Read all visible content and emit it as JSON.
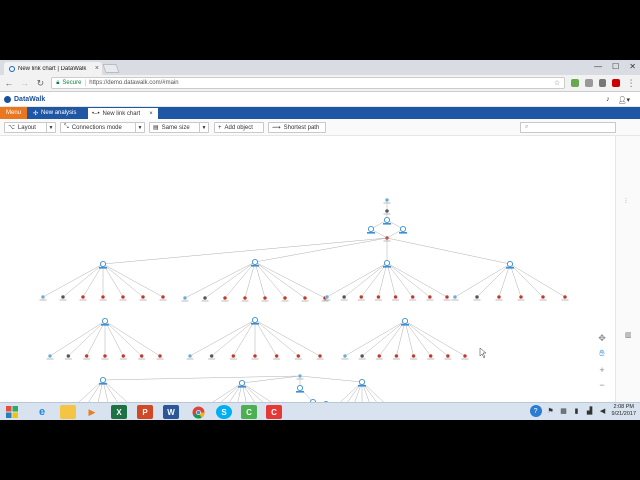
{
  "browser": {
    "tab_title": "New link chart | DataWalk",
    "tab_close": "×",
    "secure_label": "Secure",
    "url": "https://demo.datawalk.com/#main",
    "window_controls": [
      "—",
      "☐",
      "✕"
    ]
  },
  "app": {
    "logo_text": "DataWalk",
    "menu_label": "Menu",
    "tabs": [
      {
        "label": "New analysis",
        "icon": "network-icon"
      },
      {
        "label": "New link chart",
        "icon": "link-icon"
      }
    ],
    "link_tab_close": "×"
  },
  "toolbar": {
    "layout": "Layout",
    "connections_mode": "Connections mode",
    "same_size": "Same size",
    "add_object": "Add object",
    "shortest_path": "Shortest path",
    "search_placeholder": ""
  },
  "colors": {
    "nav_blue": "#1f57a4",
    "menu_orange": "#e8771f",
    "node_red": "#c0392b",
    "node_blue": "#3a8fd6",
    "edge_gray": "#9a9a9a"
  },
  "taskbar": {
    "apps": [
      "start",
      "internet-explorer",
      "file-explorer",
      "media-player",
      "excel",
      "powerpoint",
      "word",
      "chrome",
      "skype",
      "camtasia-recorder",
      "camtasia-studio"
    ],
    "time": "2:08 PM",
    "date": "9/21/2017"
  }
}
